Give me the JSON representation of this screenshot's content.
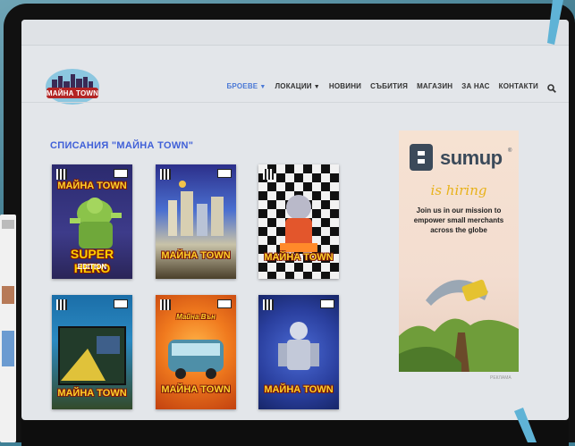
{
  "site": {
    "logo_text": "МАЙНА TOWN"
  },
  "nav": {
    "items": [
      {
        "label": "БРОЕВЕ",
        "active": true,
        "dropdown": true
      },
      {
        "label": "ЛОКАЦИИ",
        "active": false,
        "dropdown": true
      },
      {
        "label": "НОВИНИ",
        "active": false,
        "dropdown": false
      },
      {
        "label": "СЪБИТИЯ",
        "active": false,
        "dropdown": false
      },
      {
        "label": "МАГАЗИН",
        "active": false,
        "dropdown": false
      },
      {
        "label": "ЗА НАС",
        "active": false,
        "dropdown": false
      },
      {
        "label": "КОНТАКТИ",
        "active": false,
        "dropdown": false
      }
    ],
    "caret": "▼",
    "search_icon": "search-icon"
  },
  "section": {
    "title": "СПИСАНИЯ \"МАЙНА TOWN\""
  },
  "covers": [
    {
      "title": "МАЙНА TOWN",
      "subtitle": "SUPER HERO",
      "edition": "EDITION"
    },
    {
      "title": "МАЙНА TOWN"
    },
    {
      "title": "МАЙНА TOWN"
    },
    {
      "title": "МАЙНА TOWN"
    },
    {
      "title": "МАЙНА TOWN",
      "top_label": "Майна Вън"
    },
    {
      "title": "МАЙНА TOWN"
    }
  ],
  "ad": {
    "brand": "sumup",
    "reg": "®",
    "hiring": "is hiring",
    "copy": "Join us in our mission to empower small merchants across the globe",
    "label": "РЕКЛАМА"
  },
  "colors": {
    "accent": "#4b79d6",
    "title_blue": "#4060d8",
    "ad_brand": "#3b4a5a"
  }
}
